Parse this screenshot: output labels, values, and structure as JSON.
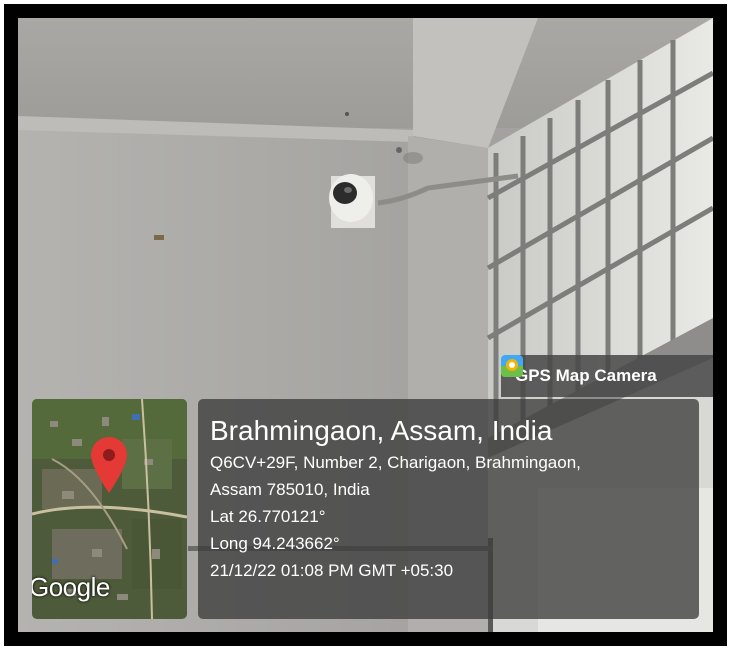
{
  "stamp": {
    "app_name": "GPS Map Camera",
    "app_icon": "gps-map-camera-app-icon"
  },
  "map": {
    "brand": "Google",
    "pin_color": "#e53935"
  },
  "location": {
    "title": "Brahmingaon, Assam, India",
    "address_line_1": "Q6CV+29F, Number 2, Charigaon, Brahmingaon,",
    "address_line_2": "Assam 785010, India",
    "latitude": "Lat 26.770121°",
    "longitude": "Long 94.243662°",
    "datetime": "21/12/22 01:08 PM GMT +05:30"
  }
}
